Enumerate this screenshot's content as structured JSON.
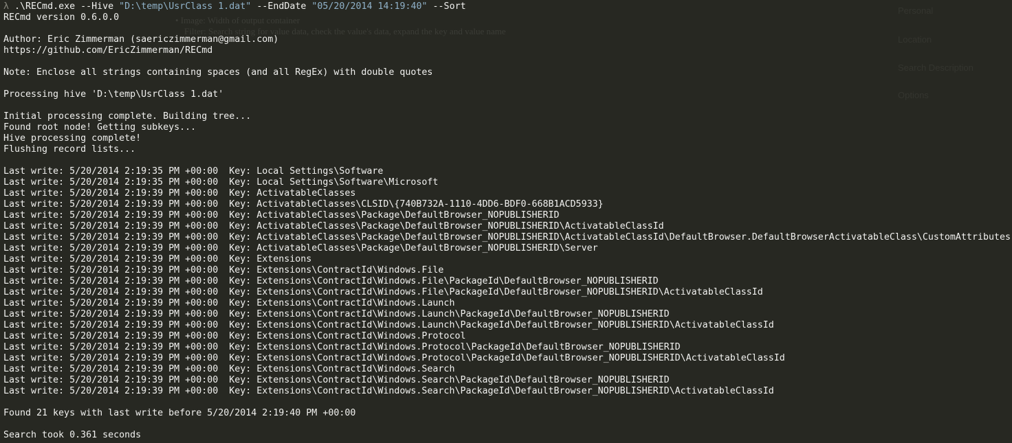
{
  "prompt": {
    "symbol": "λ",
    "exe": ".\\RECmd.exe",
    "hive_flag": "--Hive",
    "hive_value": "\"D:\\temp\\UsrClass 1.dat\"",
    "enddate_flag": "--EndDate",
    "enddate_value": "\"05/20/2014 14:19:40\"",
    "sort_flag": "--Sort"
  },
  "header": {
    "version": "RECmd version 0.6.0.0",
    "author": "Author: Eric Zimmerman (saericzimmerman@gmail.com)",
    "url": "https://github.com/EricZimmerman/RECmd",
    "note": "Note: Enclose all strings containing spaces (and all RegEx) with double quotes",
    "processing": "Processing hive 'D:\\temp\\UsrClass 1.dat'"
  },
  "progress": [
    "Initial processing complete. Building tree...",
    "Found root node! Getting subkeys...",
    "Hive processing complete!",
    "Flushing record lists..."
  ],
  "results": [
    "Last write: 5/20/2014 2:19:35 PM +00:00  Key: Local Settings\\Software",
    "Last write: 5/20/2014 2:19:35 PM +00:00  Key: Local Settings\\Software\\Microsoft",
    "Last write: 5/20/2014 2:19:39 PM +00:00  Key: ActivatableClasses",
    "Last write: 5/20/2014 2:19:39 PM +00:00  Key: ActivatableClasses\\CLSID\\{740B732A-1110-4DD6-BDF0-668B1ACD5933}",
    "Last write: 5/20/2014 2:19:39 PM +00:00  Key: ActivatableClasses\\Package\\DefaultBrowser_NOPUBLISHERID",
    "Last write: 5/20/2014 2:19:39 PM +00:00  Key: ActivatableClasses\\Package\\DefaultBrowser_NOPUBLISHERID\\ActivatableClassId",
    "Last write: 5/20/2014 2:19:39 PM +00:00  Key: ActivatableClasses\\Package\\DefaultBrowser_NOPUBLISHERID\\ActivatableClassId\\DefaultBrowser.DefaultBrowserActivatableClass\\CustomAttributes",
    "Last write: 5/20/2014 2:19:39 PM +00:00  Key: ActivatableClasses\\Package\\DefaultBrowser_NOPUBLISHERID\\Server",
    "Last write: 5/20/2014 2:19:39 PM +00:00  Key: Extensions",
    "Last write: 5/20/2014 2:19:39 PM +00:00  Key: Extensions\\ContractId\\Windows.File",
    "Last write: 5/20/2014 2:19:39 PM +00:00  Key: Extensions\\ContractId\\Windows.File\\PackageId\\DefaultBrowser_NOPUBLISHERID",
    "Last write: 5/20/2014 2:19:39 PM +00:00  Key: Extensions\\ContractId\\Windows.File\\PackageId\\DefaultBrowser_NOPUBLISHERID\\ActivatableClassId",
    "Last write: 5/20/2014 2:19:39 PM +00:00  Key: Extensions\\ContractId\\Windows.Launch",
    "Last write: 5/20/2014 2:19:39 PM +00:00  Key: Extensions\\ContractId\\Windows.Launch\\PackageId\\DefaultBrowser_NOPUBLISHERID",
    "Last write: 5/20/2014 2:19:39 PM +00:00  Key: Extensions\\ContractId\\Windows.Launch\\PackageId\\DefaultBrowser_NOPUBLISHERID\\ActivatableClassId",
    "Last write: 5/20/2014 2:19:39 PM +00:00  Key: Extensions\\ContractId\\Windows.Protocol",
    "Last write: 5/20/2014 2:19:39 PM +00:00  Key: Extensions\\ContractId\\Windows.Protocol\\PackageId\\DefaultBrowser_NOPUBLISHERID",
    "Last write: 5/20/2014 2:19:39 PM +00:00  Key: Extensions\\ContractId\\Windows.Protocol\\PackageId\\DefaultBrowser_NOPUBLISHERID\\ActivatableClassId",
    "Last write: 5/20/2014 2:19:39 PM +00:00  Key: Extensions\\ContractId\\Windows.Search",
    "Last write: 5/20/2014 2:19:39 PM +00:00  Key: Extensions\\ContractId\\Windows.Search\\PackageId\\DefaultBrowser_NOPUBLISHERID",
    "Last write: 5/20/2014 2:19:39 PM +00:00  Key: Extensions\\ContractId\\Windows.Search\\PackageId\\DefaultBrowser_NOPUBLISHERID\\ActivatableClassId"
  ],
  "summary": {
    "found": "Found 21 keys with last write before 5/20/2014 2:19:40 PM +00:00",
    "timing": "Search took 0.361 seconds"
  },
  "colors": {
    "background": "#272822",
    "text": "#f1f1ef",
    "string_arg": "#8fb1c8"
  }
}
